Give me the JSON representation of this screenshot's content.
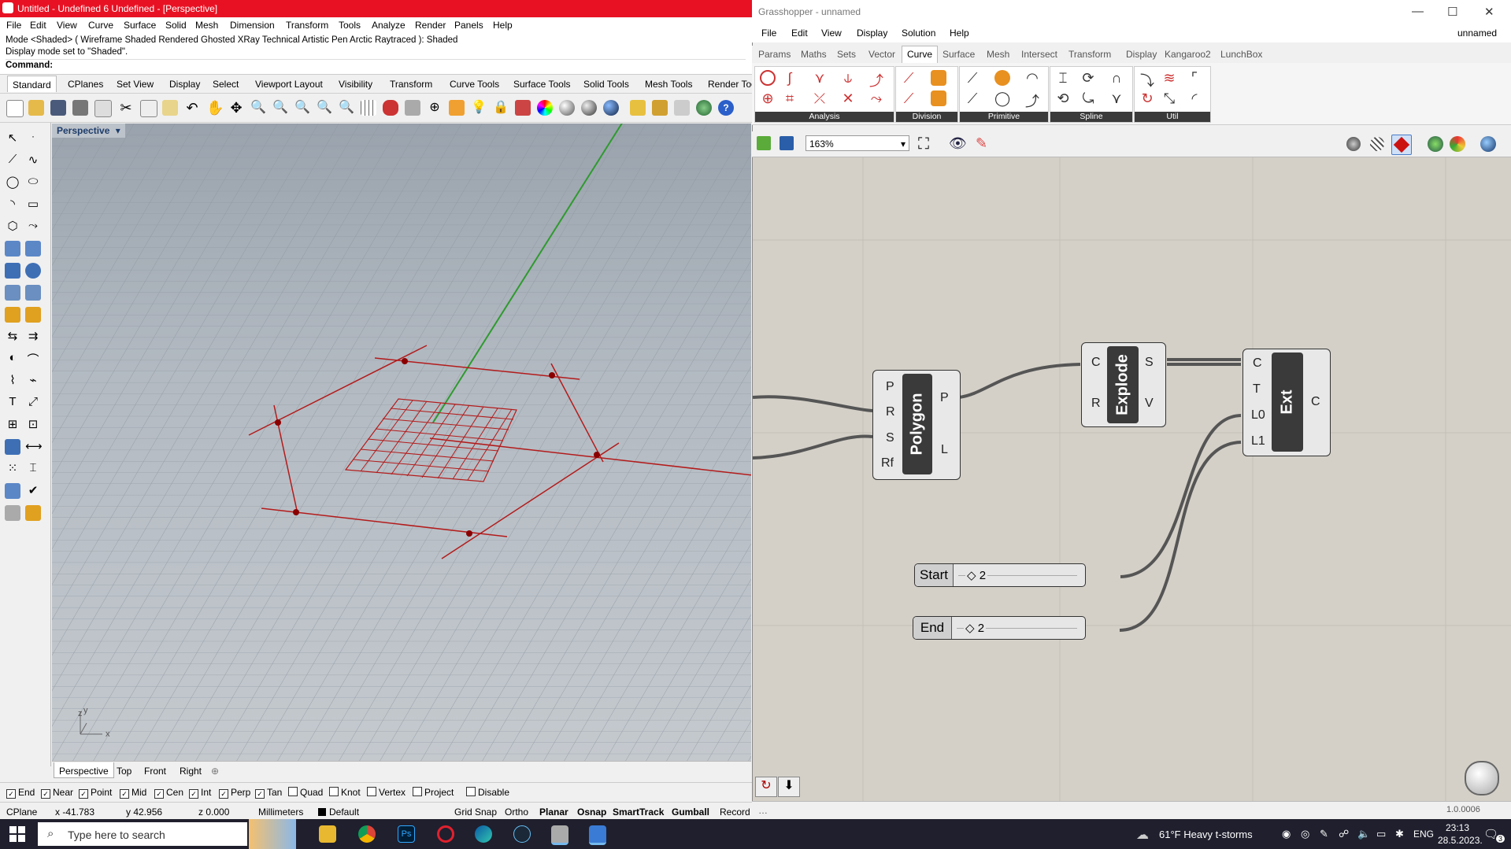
{
  "rhino": {
    "title": "Untitled - Undefined 6 Undefined - [Perspective]",
    "menu": [
      "File",
      "Edit",
      "View",
      "Curve",
      "Surface",
      "Solid",
      "Mesh",
      "Dimension",
      "Transform",
      "Tools",
      "Analyze",
      "Render",
      "Panels",
      "Help"
    ],
    "command_history": [
      "Mode <Shaded> ( Wireframe  Shaded  Rendered  Ghosted  XRay  Technical  Artistic  Pen  Arctic  Raytraced ): Shaded",
      "Display mode set to \"Shaded\"."
    ],
    "command_prompt": "Command:",
    "toolbar_tabs": [
      "Standard",
      "CPlanes",
      "Set View",
      "Display",
      "Select",
      "Viewport Layout",
      "Visibility",
      "Transform",
      "Curve Tools",
      "Surface Tools",
      "Solid Tools",
      "Mesh Tools",
      "Render Tools"
    ],
    "active_toolbar_tab": "Standard",
    "viewport_label": "Perspective",
    "axis_y": "y",
    "axis_z": "z",
    "axis_x": "x",
    "viewport_tabs": [
      "Perspective",
      "Top",
      "Front",
      "Right"
    ],
    "osnaps": [
      {
        "label": "End",
        "checked": true
      },
      {
        "label": "Near",
        "checked": true
      },
      {
        "label": "Point",
        "checked": true
      },
      {
        "label": "Mid",
        "checked": true
      },
      {
        "label": "Cen",
        "checked": true
      },
      {
        "label": "Int",
        "checked": true
      },
      {
        "label": "Perp",
        "checked": true
      },
      {
        "label": "Tan",
        "checked": true
      },
      {
        "label": "Quad",
        "checked": false
      },
      {
        "label": "Knot",
        "checked": false
      },
      {
        "label": "Vertex",
        "checked": false
      },
      {
        "label": "Project",
        "checked": false
      },
      {
        "label": "Disable",
        "checked": false
      }
    ],
    "status": {
      "cplane": "CPlane",
      "x": "x -41.783",
      "y": "y 42.956",
      "z": "z 0.000",
      "units": "Millimeters",
      "layer": "Default",
      "grid_snap": "Grid Snap",
      "ortho": "Ortho",
      "planar": "Planar",
      "osnap": "Osnap",
      "smarttrack": "SmartTrack",
      "gumball": "Gumball",
      "record": "Record"
    }
  },
  "grasshopper": {
    "title": "Grasshopper - unnamed",
    "doc_name": "unnamed",
    "menu": [
      "File",
      "Edit",
      "View",
      "Display",
      "Solution",
      "Help"
    ],
    "tabs": [
      "Params",
      "Maths",
      "Sets",
      "Vector",
      "Curve",
      "Surface",
      "Mesh",
      "Intersect",
      "Transform",
      "Display",
      "Kangaroo2",
      "LunchBox"
    ],
    "active_tab": "Curve",
    "ribbon_groups": [
      "Analysis",
      "Division",
      "Primitive",
      "Spline",
      "Util"
    ],
    "zoom": "163%",
    "components": {
      "polygon": {
        "name": "Polygon",
        "inputs": [
          "P",
          "R",
          "S",
          "Rf"
        ],
        "outputs": [
          "P",
          "L"
        ]
      },
      "explode": {
        "name": "Explode",
        "inputs": [
          "C",
          "R"
        ],
        "outputs": [
          "S",
          "V"
        ]
      },
      "ext": {
        "name": "Ext",
        "inputs": [
          "C",
          "T",
          "L0",
          "L1"
        ],
        "outputs": [
          "C"
        ]
      }
    },
    "sliders": [
      {
        "label": "Start",
        "value": "◇ 2"
      },
      {
        "label": "End",
        "value": "◇ 2"
      }
    ],
    "version": "1.0.0006"
  },
  "taskbar": {
    "search_placeholder": "Type here to search",
    "weather": "61°F  Heavy t-storms",
    "language": "ENG",
    "time": "23:13",
    "date": "28.5.2023.",
    "notifications": "3"
  }
}
